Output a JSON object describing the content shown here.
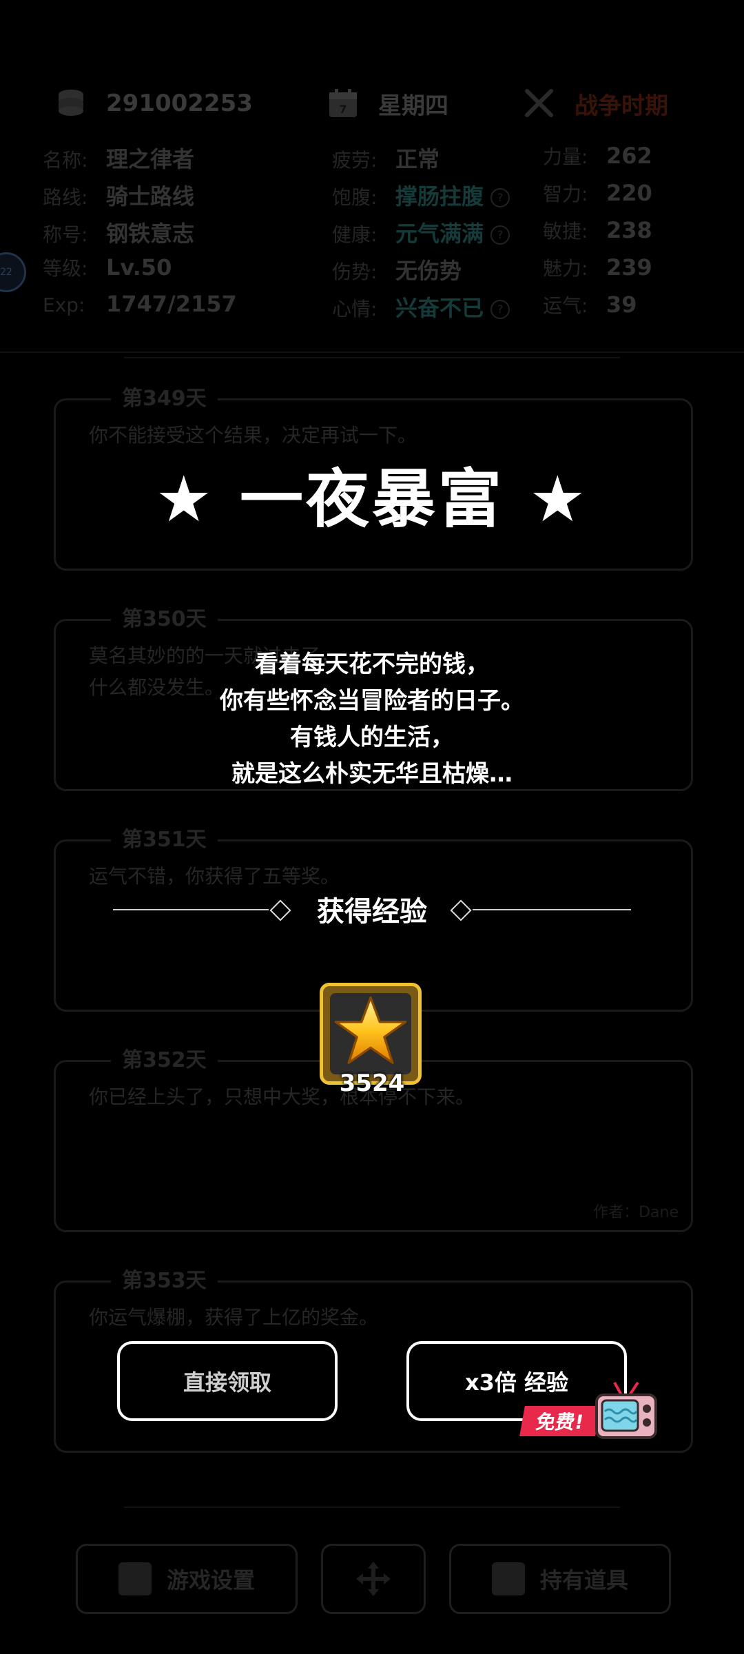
{
  "topbar": {
    "coins": "291002253",
    "weekday": "星期四",
    "calendar_day": "7",
    "war_status": "战争时期"
  },
  "stats": {
    "col1": [
      {
        "key": "名称:",
        "value": "理之律者"
      },
      {
        "key": "路线:",
        "value": "骑士路线"
      },
      {
        "key": "称号:",
        "value": "钢铁意志"
      },
      {
        "key": "等级:",
        "value": "Lv.50"
      },
      {
        "key": "Exp:",
        "value": "1747/2157"
      }
    ],
    "col2": [
      {
        "key": "疲劳:",
        "value": "正常"
      },
      {
        "key": "饱腹:",
        "value": "撑肠拄腹"
      },
      {
        "key": "健康:",
        "value": "元气满满"
      },
      {
        "key": "伤势:",
        "value": "无伤势"
      },
      {
        "key": "心情:",
        "value": "兴奋不已"
      }
    ],
    "col3": [
      {
        "key": "力量:",
        "value": "262"
      },
      {
        "key": "智力:",
        "value": "220"
      },
      {
        "key": "敏捷:",
        "value": "238"
      },
      {
        "key": "魅力:",
        "value": "239"
      },
      {
        "key": "运气:",
        "value": "39"
      }
    ],
    "help_mark": "?",
    "side_badge": "22"
  },
  "log": [
    {
      "day": "第349天",
      "text": "你不能接受这个结果，决定再试一下。",
      "author": ""
    },
    {
      "day": "第350天",
      "text": "莫名其妙的的一天就过去了，\n什么都没发生。",
      "author": ""
    },
    {
      "day": "第351天",
      "text": "运气不错，你获得了五等奖。",
      "author": ""
    },
    {
      "day": "第352天",
      "text": "你已经上头了，只想中大奖，根本停不下来。",
      "author": "作者：Dane"
    },
    {
      "day": "第353天",
      "text": "你运气爆棚，获得了上亿的奖金。",
      "author": ""
    }
  ],
  "bottom_nav": {
    "settings": "游戏设置",
    "items": "持有道具"
  },
  "event": {
    "title": "★ 一夜暴富 ★",
    "story": [
      "看着每天花不完的钱，",
      "你有些怀念当冒险者的日子。",
      "有钱人的生活，",
      "就是这么朴实无华且枯燥…"
    ],
    "exp_header": "获得经验",
    "exp_amount": "3524",
    "claim_label": "直接领取",
    "triple_label": "x3倍 经验",
    "free_label": "免费!"
  },
  "colors": {
    "accent_gold": "#f0c233",
    "free_red": "#e8294b"
  }
}
